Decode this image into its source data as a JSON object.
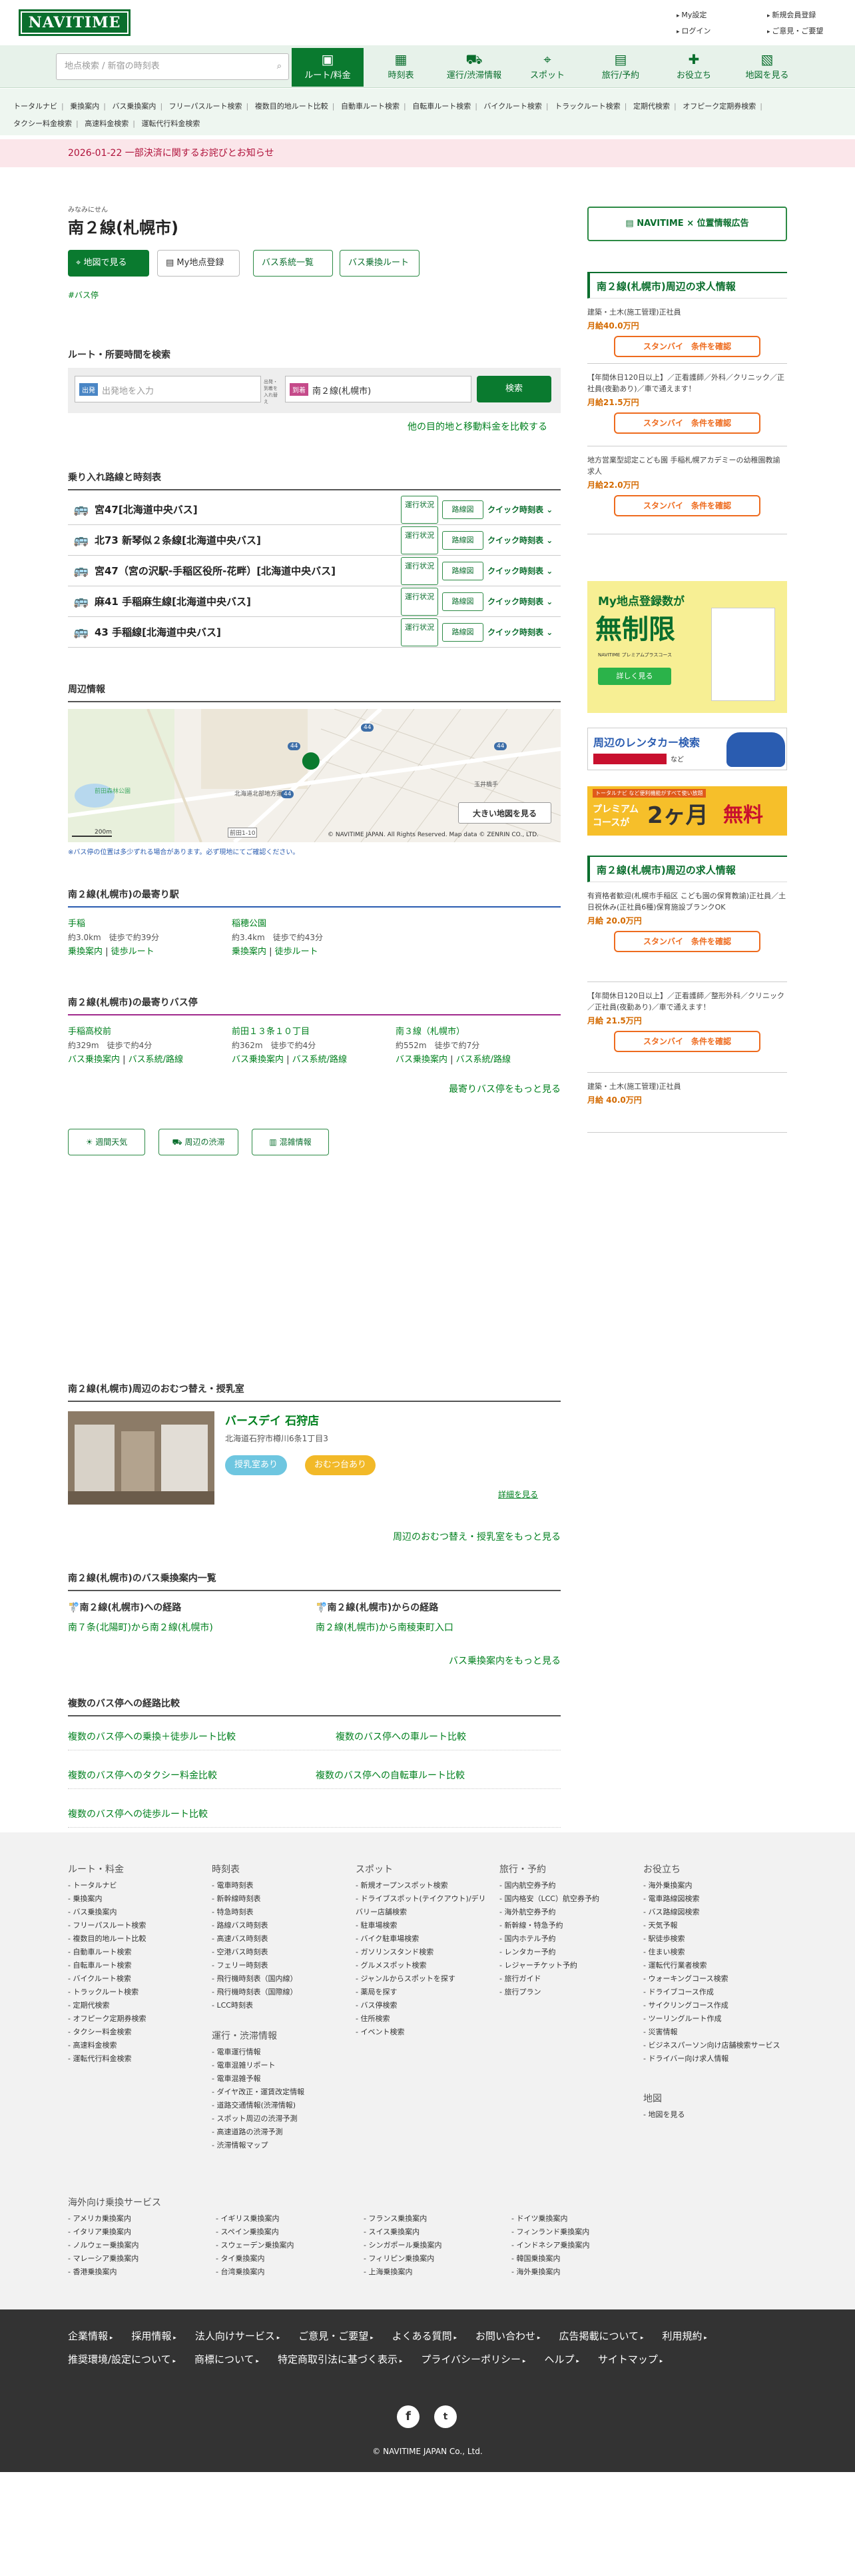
{
  "header": {
    "logo": "NAVITIME",
    "top_links": [
      "My設定",
      "ログイン",
      "新規会員登録",
      "ご意見・ご要望"
    ],
    "search_placeholder": "地点検索 / 新宿の時刻表",
    "nav": [
      {
        "icon": "ticket-icon",
        "label": "ルート/料金",
        "active": true
      },
      {
        "icon": "timetable-icon",
        "label": "時刻表",
        "active": false
      },
      {
        "icon": "train-icon",
        "label": "運行/渋滞情報",
        "active": false
      },
      {
        "icon": "pin-icon",
        "label": "スポット",
        "active": false
      },
      {
        "icon": "suitcase-icon",
        "label": "旅行/予約",
        "active": false
      },
      {
        "icon": "gift-icon",
        "label": "お役立ち",
        "active": false
      },
      {
        "icon": "map-icon",
        "label": "地図を見る",
        "active": false
      }
    ],
    "subnav": [
      "トータルナビ",
      "乗換案内",
      "バス乗換案内",
      "フリーパスルート検索",
      "複数目的地ルート比較",
      "自動車ルート検索",
      "自転車ルート検索",
      "バイクルート検索",
      "トラックルート検索",
      "定期代検索",
      "オフピーク定期券検索",
      "タクシー料金検索",
      "高速料金検索",
      "運転代行料金検索"
    ]
  },
  "notice": "2026-01-22 一部決済に関するお詫びとお知らせ",
  "stop": {
    "ruby": "みなみにせん",
    "name": "南２線(札幌市)",
    "buttons": [
      "地図で見る",
      "My地点登録",
      "バス系統一覧",
      "バス乗換ルート"
    ],
    "tag": "#バス停"
  },
  "route_search": {
    "heading": "ルート・所要時間を検索",
    "from_label": "出発",
    "from_placeholder": "出発地を入力",
    "swap": "出発・到着を入れ替え",
    "to_label": "到着",
    "to_value": "南２線(札幌市)",
    "search_btn": "検索",
    "compare_link": "他の目的地と移動料金を比較する"
  },
  "routes": {
    "heading": "乗り入れ路線と時刻表",
    "status_label": "運行状況",
    "route_label": "路線図",
    "quick_label": "クイック時刻表",
    "items": [
      "宮47[北海道中央バス]",
      "北73 新琴似２条線[北海道中央バス]",
      "宮47（宮の沢駅-手稲区役所-花畔）[北海道中央バス]",
      "麻41 手稲麻生線[北海道中央バス]",
      "43 手稲線[北海道中央バス]"
    ]
  },
  "map": {
    "heading": "周辺情報",
    "route_badges": [
      "44",
      "44",
      "44",
      "44"
    ],
    "pond": "前田森林公園",
    "place": "北海道北部地方運",
    "road": "前田1-10",
    "park": "玉井橋手",
    "scale": "200m",
    "copyright": "© NAVITIME JAPAN. All Rights Reserved. Map data © ZENRIN CO., LTD.",
    "large_btn": "大きい地図を見る",
    "note": "※バス停の位置は多少ずれる場合があります。必ず現地にてご確認ください。"
  },
  "stations": {
    "heading": "南２線(札幌市)の最寄り駅",
    "items": [
      {
        "name": "手稲",
        "dist": "約3.0km",
        "walk": "徒歩で約39分",
        "links": [
          "乗換案内",
          "徒歩ルート"
        ]
      },
      {
        "name": "稲穂公園",
        "dist": "約3.4km",
        "walk": "徒歩で約43分",
        "links": [
          "乗換案内",
          "徒歩ルート"
        ]
      }
    ]
  },
  "busstops": {
    "heading": "南２線(札幌市)の最寄りバス停",
    "items": [
      {
        "name": "手稲高校前",
        "dist": "約329m",
        "walk": "徒歩で約4分",
        "links": [
          "バス乗換案内",
          "バス系統/路線"
        ]
      },
      {
        "name": "前田１３条１０丁目",
        "dist": "約362m",
        "walk": "徒歩で約4分",
        "links": [
          "バス乗換案内",
          "バス系統/路線"
        ]
      },
      {
        "name": "南３線（札幌市）",
        "dist": "約552m",
        "walk": "徒歩で約7分",
        "links": [
          "バス乗換案内",
          "バス系統/路線"
        ]
      }
    ],
    "more": "最寄りバス停をもっと見る"
  },
  "extras": [
    "週間天気",
    "周辺の渋滞",
    "混雑情報"
  ],
  "nursing": {
    "heading": "南２線(札幌市)周辺のおむつ替え・授乳室",
    "shop": "バースデイ 石狩店",
    "address": "北海道石狩市樽川6条1丁目3",
    "tags": [
      "授乳室あり",
      "おむつ台あり"
    ],
    "detail": "詳細を見る",
    "more": "周辺のおむつ替え・授乳室をもっと見る"
  },
  "bus_routes": {
    "heading": "南２線(札幌市)のバス乗換案内一覧",
    "to_title": "南２線(札幌市)への経路",
    "to_link": "南７条(北陽町)から南２線(札幌市)",
    "from_title": "南２線(札幌市)からの経路",
    "from_link": "南２線(札幌市)から南稜東町入口",
    "more": "バス乗換案内をもっと見る"
  },
  "compare": {
    "heading": "複数のバス停への経路比較",
    "links": [
      "複数のバス停への乗換＋徒歩ルート比較",
      "複数のバス停への車ルート比較",
      "複数のバス停へのタクシー料金比較",
      "複数のバス停への自転車ルート比較",
      "複数のバス停への徒歩ルート比較"
    ]
  },
  "sidebar": {
    "ad_top": "NAVITIME × 位置情報広告",
    "jobs_heading": "南２線(札幌市)周辺の求人情報",
    "jobs1": [
      {
        "title": "建築・土木(施工管理)正社員",
        "salary": "月給40.0万円"
      },
      {
        "title": "【年間休日120日以上】／正看護師／外科／クリニック／正社員(夜勤あり)／車で通えます！",
        "salary": "月給21.5万円"
      },
      {
        "title": "地方営業型認定こども園 手稲札幌アカデミーの幼稚園教諭求人",
        "salary": "月給22.0万円"
      }
    ],
    "job_btn_brand": "スタンバイ",
    "job_btn": "条件を確認",
    "promo1": [
      "My地点登録数が",
      "無制限",
      "NAVITIME プレミアムプラスコース",
      "詳しく見る"
    ],
    "rental": "周辺のレンタカー検索",
    "rental_sub": "など",
    "premium": [
      "トータルナビ など便利機能がすべて使い放題",
      "プレミアム",
      "コースが",
      "2ヶ月",
      "無料"
    ],
    "jobs2": [
      {
        "title": "有資格者歓迎(札幌市手稲区 こども園の保育教諭)正社員／土日祝休み(正社員6種)保育施設ブランクOK",
        "salary": "月給 20.0万円"
      },
      {
        "title": "【年間休日120日以上】／正看護師／整形外科／クリニック／正社員(夜勤あり)／車で通えます！",
        "salary": "月給 21.5万円"
      },
      {
        "title": "建築・土木(施工管理)正社員",
        "salary": "月給 40.0万円"
      }
    ]
  },
  "footer": {
    "cols": [
      {
        "head": "ルート・料金",
        "items": [
          "トータルナビ",
          "乗換案内",
          "バス乗換案内",
          "フリーパスルート検索",
          "複数目的地ルート比較",
          "自動車ルート検索",
          "自転車ルート検索",
          "バイクルート検索",
          "トラックルート検索",
          "定期代検索",
          "オフピーク定期券検索",
          "タクシー料金検索",
          "高速料金検索",
          "運転代行料金検索"
        ]
      },
      {
        "head": "時刻表",
        "items": [
          "電車時刻表",
          "新幹線時刻表",
          "特急時刻表",
          "路線バス時刻表",
          "高速バス時刻表",
          "空港バス時刻表",
          "フェリー時刻表",
          "飛行機時刻表（国内線）",
          "飛行機時刻表（国際線）",
          "LCC時刻表"
        ]
      },
      {
        "head": "運行・渋滞情報",
        "items": [
          "電車運行情報",
          "電車混雑リポート",
          "電車混雑予報",
          "ダイヤ改正・運賃改定情報",
          "道路交通情報(渋滞情報)",
          "スポット周辺の渋滞予測",
          "高速道路の渋滞予測",
          "渋滞情報マップ"
        ]
      },
      {
        "head": "スポット",
        "items": [
          "新規オープンスポット検索",
          "ドライブスポット(テイクアウト)/デリバリー店舗検索",
          "駐車場検索",
          "バイク駐車場検索",
          "ガソリンスタンド検索",
          "グルメスポット検索",
          "ジャンルからスポットを探す",
          "薬局を探す",
          "バス停検索",
          "住所検索",
          "イベント検索"
        ]
      },
      {
        "head": "旅行・予約",
        "items": [
          "国内航空券予約",
          "国内格安（LCC）航空券予約",
          "海外航空券予約",
          "新幹線・特急予約",
          "国内ホテル予約",
          "レンタカー予約",
          "レジャーチケット予約",
          "旅行ガイド",
          "旅行プラン"
        ]
      },
      {
        "head": "お役立ち",
        "items": [
          "海外乗換案内",
          "電車路線図検索",
          "バス路線図検索",
          "天気予報",
          "駅徒歩検索",
          "住まい検索",
          "運転代行業者検索",
          "ウォーキングコース検索",
          "ドライブコース作成",
          "サイクリングコース作成",
          "ツーリングルート作成",
          "災害情報",
          "ビジネスパーソン向け店舗検索サービス",
          "ドライバー向け求人情報"
        ]
      },
      {
        "head": "地図",
        "items": [
          "地図を見る"
        ]
      }
    ],
    "overseas_head": "海外向け乗換サービス",
    "overseas": [
      "アメリカ乗換案内",
      "イタリア乗換案内",
      "ノルウェー乗換案内",
      "マレーシア乗換案内",
      "香港乗換案内",
      "イギリス乗換案内",
      "スペイン乗換案内",
      "スウェーデン乗換案内",
      "タイ乗換案内",
      "台湾乗換案内",
      "フランス乗換案内",
      "スイス乗換案内",
      "シンガポール乗換案内",
      "フィリピン乗換案内",
      "上海乗換案内",
      "ドイツ乗換案内",
      "フィンランド乗換案内",
      "インドネシア乗換案内",
      "韓国乗換案内",
      "海外乗換案内"
    ],
    "bottom_links": [
      "企業情報",
      "採用情報",
      "法人向けサービス",
      "ご意見・ご要望",
      "よくある質問",
      "お問い合わせ",
      "広告掲載について",
      "利用規約",
      "推奨環境/設定について",
      "商標について",
      "特定商取引法に基づく表示",
      "プライバシーポリシー",
      "ヘルプ",
      "サイトマップ"
    ],
    "social": [
      "facebook-icon",
      "twitter-icon"
    ],
    "copyright": "© NAVITIME JAPAN Co., Ltd."
  }
}
